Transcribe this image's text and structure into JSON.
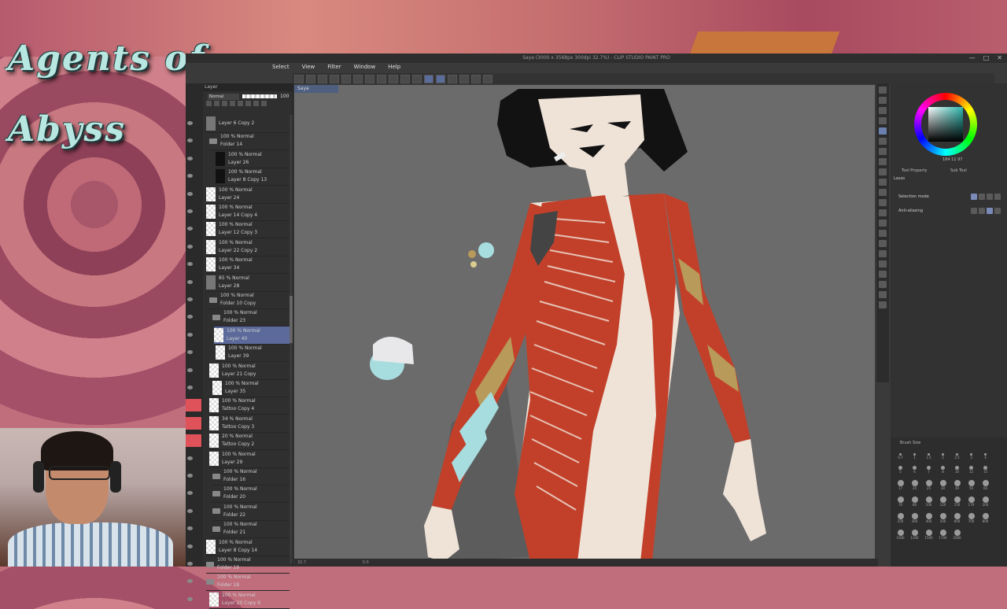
{
  "stream": {
    "logo_text": "Agents of Abyss"
  },
  "window": {
    "title": "Saya (3000 x 3568px 300dpi 32.7%) - CLIP STUDIO PAINT PRO",
    "controls": [
      "—",
      "□",
      "✕"
    ]
  },
  "menu": [
    "Select",
    "View",
    "Filter",
    "Window",
    "Help"
  ],
  "layer_panel": {
    "tab_label": "Layer",
    "blend_mode": "Normal",
    "opacity": "100"
  },
  "layers": [
    {
      "mode": "",
      "name": "Layer 6 Copy 2",
      "kind": "layer",
      "thumb": "grey"
    },
    {
      "mode": "100 % Normal",
      "name": "Folder 14",
      "kind": "folder"
    },
    {
      "mode": "100 % Normal",
      "name": "Layer 26",
      "kind": "layer",
      "thumb": "black"
    },
    {
      "mode": "100 % Normal",
      "name": "Layer 8 Copy 13",
      "kind": "layer",
      "thumb": "black"
    },
    {
      "mode": "100 % Normal",
      "name": "Layer 24",
      "kind": "layer"
    },
    {
      "mode": "100 % Normal",
      "name": "Layer 14 Copy 4",
      "kind": "layer"
    },
    {
      "mode": "100 % Normal",
      "name": "Layer 12 Copy 3",
      "kind": "layer"
    },
    {
      "mode": "100 % Normal",
      "name": "Layer 22 Copy 2",
      "kind": "layer"
    },
    {
      "mode": "100 % Normal",
      "name": "Layer 34",
      "kind": "layer"
    },
    {
      "mode": "85 % Normal",
      "name": "Layer 28",
      "kind": "layer",
      "thumb": "grey"
    },
    {
      "mode": "100 % Normal",
      "name": "Folder 10 Copy",
      "kind": "folder"
    },
    {
      "mode": "100 % Normal",
      "name": "Folder 23",
      "kind": "folder"
    },
    {
      "mode": "100 % Normal",
      "name": "Layer 40",
      "kind": "layer",
      "selected": true
    },
    {
      "mode": "100 % Normal",
      "name": "Layer 39",
      "kind": "layer"
    },
    {
      "mode": "100 % Normal",
      "name": "Layer 21 Copy",
      "kind": "layer"
    },
    {
      "mode": "100 % Normal",
      "name": "Layer 35",
      "kind": "layer"
    },
    {
      "mode": "100 % Normal",
      "name": "Tattoo Copy 4",
      "kind": "layer"
    },
    {
      "mode": "34 % Normal",
      "name": "Tattoo Copy 3",
      "kind": "layer"
    },
    {
      "mode": "20 % Normal",
      "name": "Tattoo Copy 2",
      "kind": "layer"
    },
    {
      "mode": "100 % Normal",
      "name": "Layer 29",
      "kind": "layer"
    },
    {
      "mode": "100 % Normal",
      "name": "Folder 16",
      "kind": "folder"
    },
    {
      "mode": "100 % Normal",
      "name": "Folder 20",
      "kind": "folder"
    },
    {
      "mode": "100 % Normal",
      "name": "Folder 22",
      "kind": "folder"
    },
    {
      "mode": "100 % Normal",
      "name": "Folder 21",
      "kind": "folder"
    },
    {
      "mode": "100 % Normal",
      "name": "Layer 8 Copy 14",
      "kind": "layer"
    },
    {
      "mode": "100 % Normal",
      "name": "Folder 19",
      "kind": "folder"
    },
    {
      "mode": "100 % Normal",
      "name": "Folder 18",
      "kind": "folder"
    },
    {
      "mode": "100 % Normal",
      "name": "Layer 20 Copy 6",
      "kind": "layer"
    }
  ],
  "canvas": {
    "tab_label": "Saya",
    "zoom": "32.7",
    "angle": "0.0"
  },
  "right_panel": {
    "color_readout": "184  11  97",
    "tab_tool_property": "Tool Property",
    "tab_sub_tool": "Sub Tool",
    "tool_name": "Lasso",
    "selection_mode_label": "Selection mode",
    "anti_aliasing_label": "Anti-aliasing",
    "brush_size_title": "Brush Size"
  },
  "brush_sizes": [
    "0.7",
    "1",
    "1.5",
    "2",
    "2.5",
    "3",
    "4",
    "5",
    "6",
    "7",
    "8",
    "10",
    "12",
    "15",
    "17",
    "20",
    "25",
    "30",
    "40",
    "50",
    "60",
    "70",
    "80",
    "100",
    "120",
    "150",
    "170",
    "200",
    "250",
    "300",
    "400",
    "500",
    "600",
    "700",
    "800",
    "1000",
    "1200",
    "1500",
    "1700",
    "2000"
  ],
  "colors": {
    "accent": "#5b6a9a",
    "skin": "#efe3d8",
    "tattoo_red": "#c2402a",
    "tattoo_gold": "#b89a5a",
    "tattoo_blue": "#a8dde0",
    "hair": "#121212"
  }
}
